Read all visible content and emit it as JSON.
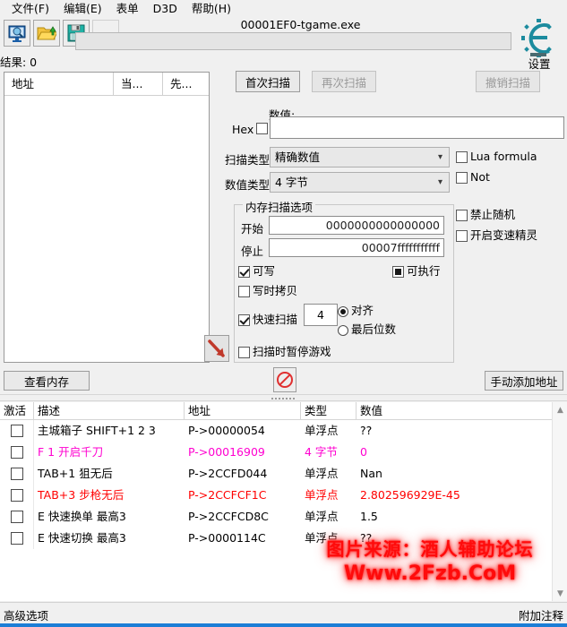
{
  "menu": {
    "items": [
      {
        "label": "文件(F)",
        "accel": "F"
      },
      {
        "label": "编辑(E)",
        "accel": "E"
      },
      {
        "label": "表单",
        "accel": ""
      },
      {
        "label": "D3D",
        "accel": ""
      },
      {
        "label": "帮助(H)",
        "accel": "H"
      }
    ]
  },
  "toolbar": {
    "icons": [
      {
        "name": "process-select-icon"
      },
      {
        "name": "open-file-icon"
      },
      {
        "name": "save-file-icon"
      }
    ],
    "process_title": "00001EF0-tgame.exe",
    "logo_caption": "设置"
  },
  "results": {
    "label": "结果: 0",
    "columns": [
      "地址",
      "当...",
      "先..."
    ]
  },
  "scan_buttons": {
    "first": "首次扫描",
    "next": "再次扫描",
    "undo": "撤销扫描"
  },
  "value_section": {
    "value_label": "数值:",
    "hex_label": "Hex",
    "hex_checked": false,
    "value": "",
    "value_placeholder": ""
  },
  "types": {
    "scan_type_label": "扫描类型",
    "scan_type_value": "精确数值",
    "value_type_label": "数值类型",
    "value_type_value": "4 字节"
  },
  "side_options": [
    {
      "label": "Lua formula",
      "checked": false
    },
    {
      "label": "Not",
      "checked": false
    },
    {
      "label": "禁止随机",
      "checked": false
    },
    {
      "label": "开启变速精灵",
      "checked": false
    }
  ],
  "mem_options": {
    "title": "内存扫描选项",
    "start_label": "开始",
    "start_value": "0000000000000000",
    "stop_label": "停止",
    "stop_value": "00007fffffffffff",
    "writable": {
      "label": "可写",
      "state": "checked"
    },
    "executable": {
      "label": "可执行",
      "state": "indeterminate"
    },
    "copy_on_write": {
      "label": "写时拷贝",
      "state": "unchecked"
    },
    "fast_scan": {
      "label": "快速扫描",
      "state": "checked"
    },
    "fast_scan_value": "4",
    "align_radio": {
      "label": "对齐",
      "selected": true
    },
    "lastdigits_radio": {
      "label": "最后位数",
      "selected": false
    },
    "pause_on_scan": {
      "label": "扫描时暂停游戏",
      "state": "unchecked"
    }
  },
  "mid_buttons": {
    "view_memory": "查看内存",
    "add_address": "手动添加地址",
    "no_entry_icon": "no-entry-icon"
  },
  "annotation": {
    "arrow_icon": "red-arrow-down-right-icon"
  },
  "cheat_table": {
    "columns": [
      "激活",
      "描述",
      "地址",
      "类型",
      "数值"
    ],
    "rows": [
      {
        "active": false,
        "desc": "主城箱子 SHIFT+1 2 3",
        "address": "P->00000054",
        "type": "单浮点",
        "value": "??",
        "color": "#000000"
      },
      {
        "active": false,
        "desc": "F 1 开启千刀",
        "address": "P->00016909",
        "type": "4 字节",
        "value": "0",
        "color": "#FF00D0"
      },
      {
        "active": false,
        "desc": "TAB+1 狙无后",
        "address": "P->2CCFD044",
        "type": "单浮点",
        "value": "Nan",
        "color": "#000000"
      },
      {
        "active": false,
        "desc": "TAB+3 步枪无后",
        "address": "P->2CCFCF1C",
        "type": "单浮点",
        "value": "2.802596929E-45",
        "color": "#FF0000"
      },
      {
        "active": false,
        "desc": "E 快速换单 最高3",
        "address": "P->2CCFCD8C",
        "type": "单浮点",
        "value": "1.5",
        "color": "#000000"
      },
      {
        "active": false,
        "desc": "E 快速切换 最高3",
        "address": "P->0000114C",
        "type": "单浮点",
        "value": "??",
        "color": "#000000"
      }
    ]
  },
  "watermark": {
    "line1": "图片来源：酒人辅助论坛",
    "line2": "Www.2Fzb.CoM"
  },
  "statusbar": {
    "left": "高级选项",
    "right": "附加注释"
  },
  "colors": {
    "accent": "#1C7ED6",
    "logo": "#1C8B9E",
    "row_magenta": "#FF00D0",
    "row_red": "#FF0000",
    "watermark": "#FF0B0B"
  }
}
